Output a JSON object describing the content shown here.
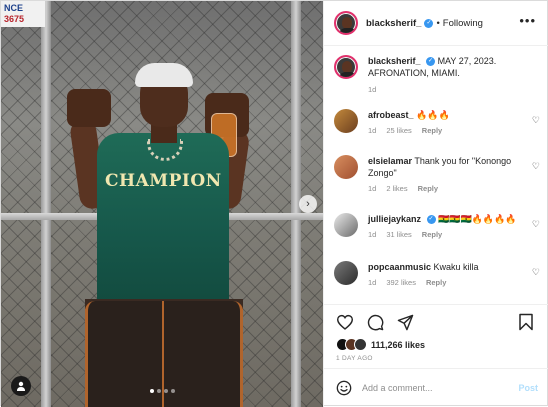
{
  "photo": {
    "sign_text_line1": "NCE",
    "sign_text_line2": "3675",
    "shirt_text": "CHAMPION"
  },
  "header": {
    "username": "blacksherif_",
    "separator": "•",
    "following_label": "Following",
    "more_label": "•••"
  },
  "caption": {
    "username": "blacksherif_",
    "text": "MAY 27, 2023. AFRONATION, MIAMI.",
    "time": "1d"
  },
  "comments": [
    {
      "username": "afrobeast_",
      "text": "🔥🔥🔥",
      "time": "1d",
      "likes": "25 likes",
      "reply": "Reply"
    },
    {
      "username": "elsielamar",
      "text": "Thank you for \"Konongo Zongo\"",
      "time": "1d",
      "likes": "2 likes",
      "reply": "Reply"
    },
    {
      "username": "julliejaykanz",
      "text": "🇬🇭🇬🇭🇬🇭🔥🔥🔥🔥",
      "time": "1d",
      "likes": "31 likes",
      "reply": "Reply"
    },
    {
      "username": "popcaanmusic",
      "text": "Kwaku killa",
      "time": "1d",
      "likes": "392 likes",
      "reply": "Reply"
    }
  ],
  "actions": {
    "likes_count": "111,266 likes",
    "date": "1 DAY AGO"
  },
  "add_comment": {
    "placeholder": "Add a comment...",
    "post_label": "Post"
  },
  "icons": {
    "heart": "heart-icon",
    "comment": "comment-icon",
    "share": "share-icon",
    "save": "bookmark-icon",
    "emoji": "emoji-icon",
    "verified": "verified-badge-icon"
  },
  "colors": {
    "verified_blue": "#3897f0",
    "post_button_disabled": "#b2dffc",
    "muted_text": "#8e8e8e"
  }
}
